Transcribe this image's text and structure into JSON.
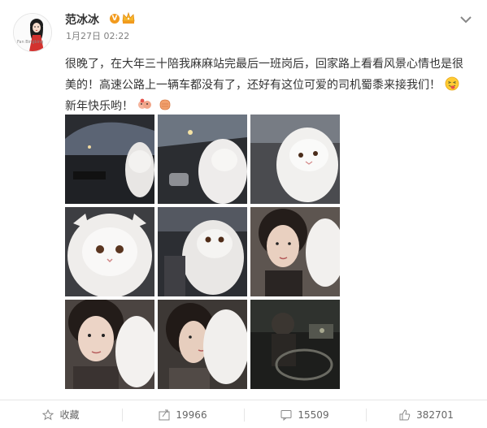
{
  "post": {
    "author": "范冰冰",
    "verified_badge": "V",
    "avatar_caption": "Fan Bingbing",
    "timestamp": "1月27日 02:22",
    "text_part1": "很晚了，在大年三十陪我麻麻站完最后一班岗后，回家路上看看风景心情也是很美的！高速公路上一辆车都没有了，还好有这位可爱的司机蜀黍来接我们！",
    "text_part2": "新年快乐哟！",
    "emojis": [
      "tongue-out-emoji",
      "couple-emoji",
      "fist-emoji"
    ],
    "photo_count": 9,
    "photos": [
      "car-night-cat-photo",
      "cat-by-car-window-photo",
      "cat-in-car-photo",
      "cat-closeup-photo",
      "cat-face-night-photo",
      "woman-with-cat-photo",
      "woman-selfie-with-cat-photo",
      "woman-kissing-cat-photo",
      "driver-car-interior-photo"
    ]
  },
  "actions": {
    "favorite_label": "收藏",
    "repost_count": "19966",
    "comment_count": "15509",
    "like_count": "382701"
  },
  "colors": {
    "text": "#333333",
    "meta": "#808080",
    "verified": "#f29a1d",
    "divider": "#e6e6e6"
  }
}
